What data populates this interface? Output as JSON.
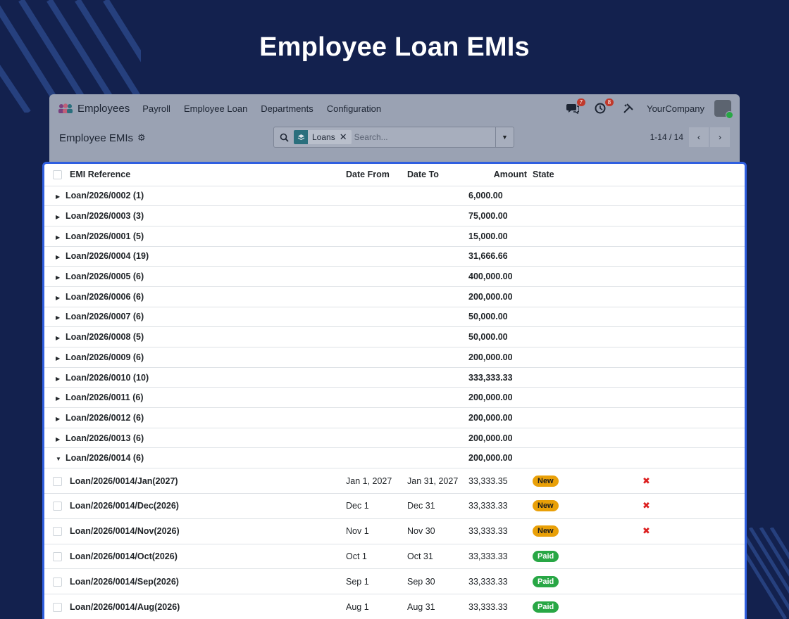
{
  "hero_title": "Employee Loan EMIs",
  "navbar": {
    "app_name": "Employees",
    "menu": [
      "Payroll",
      "Employee Loan",
      "Departments",
      "Configuration"
    ],
    "messages_count": "7",
    "activity_count": "8",
    "company": "YourCompany"
  },
  "control": {
    "breadcrumb": "Employee EMIs",
    "facet_label": "Loans",
    "search_placeholder": "Search...",
    "pager_value": "1-14 / 14"
  },
  "table": {
    "headers": {
      "ref": "EMI Reference",
      "date_from": "Date From",
      "date_to": "Date To",
      "amount": "Amount",
      "state": "State"
    },
    "groups": [
      {
        "label": "Loan/2026/0002 (1)",
        "amount": "6,000.00"
      },
      {
        "label": "Loan/2026/0003 (3)",
        "amount": "75,000.00"
      },
      {
        "label": "Loan/2026/0001 (5)",
        "amount": "15,000.00"
      },
      {
        "label": "Loan/2026/0004 (19)",
        "amount": "31,666.66"
      },
      {
        "label": "Loan/2026/0005 (6)",
        "amount": "400,000.00"
      },
      {
        "label": "Loan/2026/0006 (6)",
        "amount": "200,000.00"
      },
      {
        "label": "Loan/2026/0007 (6)",
        "amount": "50,000.00"
      },
      {
        "label": "Loan/2026/0008 (5)",
        "amount": "50,000.00"
      },
      {
        "label": "Loan/2026/0009 (6)",
        "amount": "200,000.00"
      },
      {
        "label": "Loan/2026/0010 (10)",
        "amount": "333,333.33"
      },
      {
        "label": "Loan/2026/0011 (6)",
        "amount": "200,000.00"
      },
      {
        "label": "Loan/2026/0012 (6)",
        "amount": "200,000.00"
      },
      {
        "label": "Loan/2026/0013 (6)",
        "amount": "200,000.00"
      },
      {
        "label": "Loan/2026/0014 (6)",
        "amount": "200,000.00"
      }
    ],
    "records": [
      {
        "ref": "Loan/2026/0014/Jan(2027)",
        "date_from": "Jan 1, 2027",
        "date_to": "Jan 31, 2027",
        "amount": "33,333.35",
        "state": "New"
      },
      {
        "ref": "Loan/2026/0014/Dec(2026)",
        "date_from": "Dec 1",
        "date_to": "Dec 31",
        "amount": "33,333.33",
        "state": "New"
      },
      {
        "ref": "Loan/2026/0014/Nov(2026)",
        "date_from": "Nov 1",
        "date_to": "Nov 30",
        "amount": "33,333.33",
        "state": "New"
      },
      {
        "ref": "Loan/2026/0014/Oct(2026)",
        "date_from": "Oct 1",
        "date_to": "Oct 31",
        "amount": "33,333.33",
        "state": "Paid"
      },
      {
        "ref": "Loan/2026/0014/Sep(2026)",
        "date_from": "Sep 1",
        "date_to": "Sep 30",
        "amount": "33,333.33",
        "state": "Paid"
      },
      {
        "ref": "Loan/2026/0014/Aug(2026)",
        "date_from": "Aug 1",
        "date_to": "Aug 31",
        "amount": "33,333.33",
        "state": "Paid"
      }
    ]
  },
  "colors": {
    "background": "#13214e",
    "highlight": "#2f5fe0",
    "new": "#e9a008",
    "paid": "#28a745"
  }
}
